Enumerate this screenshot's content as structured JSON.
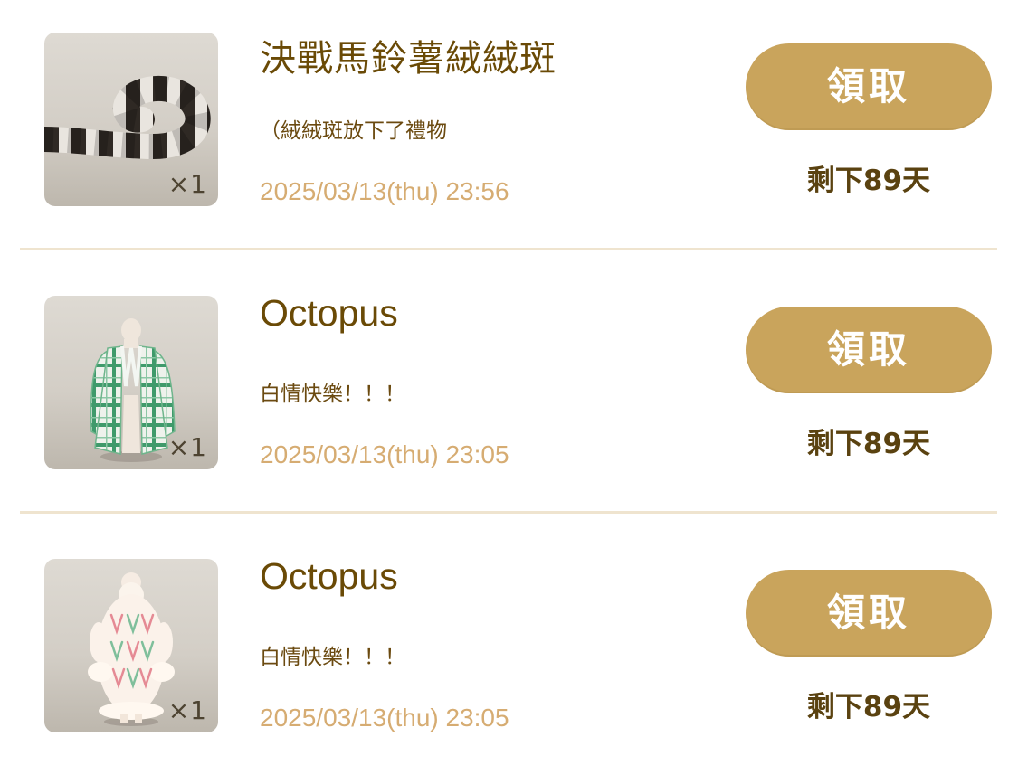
{
  "gifts": [
    {
      "title": "決戰馬鈴薯絨絨斑",
      "message": "（絨絨斑放下了禮物",
      "date": "2025/03/13(thu) 23:56",
      "quantity": "×1",
      "item_icon": "striped-tail-icon",
      "claim_label": "領取",
      "remaining": "剩下89天"
    },
    {
      "title": "Octopus",
      "message": "白情快樂！！！",
      "date": "2025/03/13(thu) 23:05",
      "quantity": "×1",
      "item_icon": "green-plaid-coat-icon",
      "claim_label": "領取",
      "remaining": "剩下89天"
    },
    {
      "title": "Octopus",
      "message": "白情快樂！！！",
      "date": "2025/03/13(thu) 23:05",
      "quantity": "×1",
      "item_icon": "fluffy-cream-coat-icon",
      "claim_label": "領取",
      "remaining": "剩下89天"
    }
  ],
  "colors": {
    "title": "#6a4a06",
    "date": "#d6ac72",
    "button": "#c9a45c",
    "divider": "#efe4cf",
    "remaining": "#5a4210"
  }
}
